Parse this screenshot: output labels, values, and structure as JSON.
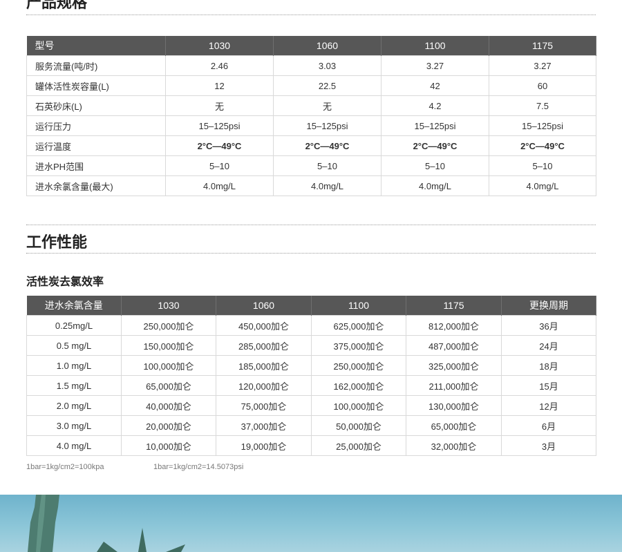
{
  "spec_section": {
    "title": "产品规格",
    "headers": [
      "型号",
      "1030",
      "1060",
      "1100",
      "1175"
    ],
    "rows": [
      {
        "label": "服务流量(吨/时)",
        "values": [
          "2.46",
          "3.03",
          "3.27",
          "3.27"
        ],
        "bold": false
      },
      {
        "label": "罐体活性炭容量(L)",
        "values": [
          "12",
          "22.5",
          "42",
          "60"
        ],
        "bold": false
      },
      {
        "label": "石英砂床(L)",
        "values": [
          "无",
          "无",
          "4.2",
          "7.5"
        ],
        "bold": false
      },
      {
        "label": "运行压力",
        "values": [
          "15–125psi",
          "15–125psi",
          "15–125psi",
          "15–125psi"
        ],
        "bold": false
      },
      {
        "label": "运行温度",
        "values": [
          "2°C—49°C",
          "2°C—49°C",
          "2°C—49°C",
          "2°C—49°C"
        ],
        "bold": true
      },
      {
        "label": "进水PH范围",
        "values": [
          "5–10",
          "5–10",
          "5–10",
          "5–10"
        ],
        "bold": false
      },
      {
        "label": "进水余氯含量(最大)",
        "values": [
          "4.0mg/L",
          "4.0mg/L",
          "4.0mg/L",
          "4.0mg/L"
        ],
        "bold": false
      }
    ]
  },
  "performance_section": {
    "title": "工作性能",
    "subtitle": "活性炭去氯效率",
    "headers": [
      "进水余氯含量",
      "1030",
      "1060",
      "1100",
      "1175",
      "更换周期"
    ],
    "rows": [
      [
        "0.25mg/L",
        "250,000加仑",
        "450,000加仑",
        "625,000加仑",
        "812,000加仑",
        "36月"
      ],
      [
        "0.5 mg/L",
        "150,000加仑",
        "285,000加仑",
        "375,000加仑",
        "487,000加仑",
        "24月"
      ],
      [
        "1.0 mg/L",
        "100,000加仑",
        "185,000加仑",
        "250,000加仑",
        "325,000加仑",
        "18月"
      ],
      [
        "1.5 mg/L",
        "65,000加仑",
        "120,000加仑",
        "162,000加仑",
        "211,000加仑",
        "15月"
      ],
      [
        "2.0 mg/L",
        "40,000加仑",
        "75,000加仑",
        "100,000加仑",
        "130,000加仑",
        "12月"
      ],
      [
        "3.0 mg/L",
        "20,000加仑",
        "37,000加仑",
        "50,000加仑",
        "65,000加仑",
        "6月"
      ],
      [
        "4.0 mg/L",
        "10,000加仑",
        "19,000加仑",
        "25,000加仑",
        "32,000加仑",
        "3月"
      ]
    ],
    "notes": [
      "1bar=1kg/cm2=100kpa",
      "1bar=1kg/cm2=14.5073psi"
    ]
  },
  "colors": {
    "header_bg": "#575757",
    "header_text": "#ffffff",
    "border": "#d9d9d9",
    "banner_sky": "#8cc6d8",
    "statue": "#4d7c70"
  },
  "banner": {
    "image": "statue-of-liberty-photo"
  }
}
